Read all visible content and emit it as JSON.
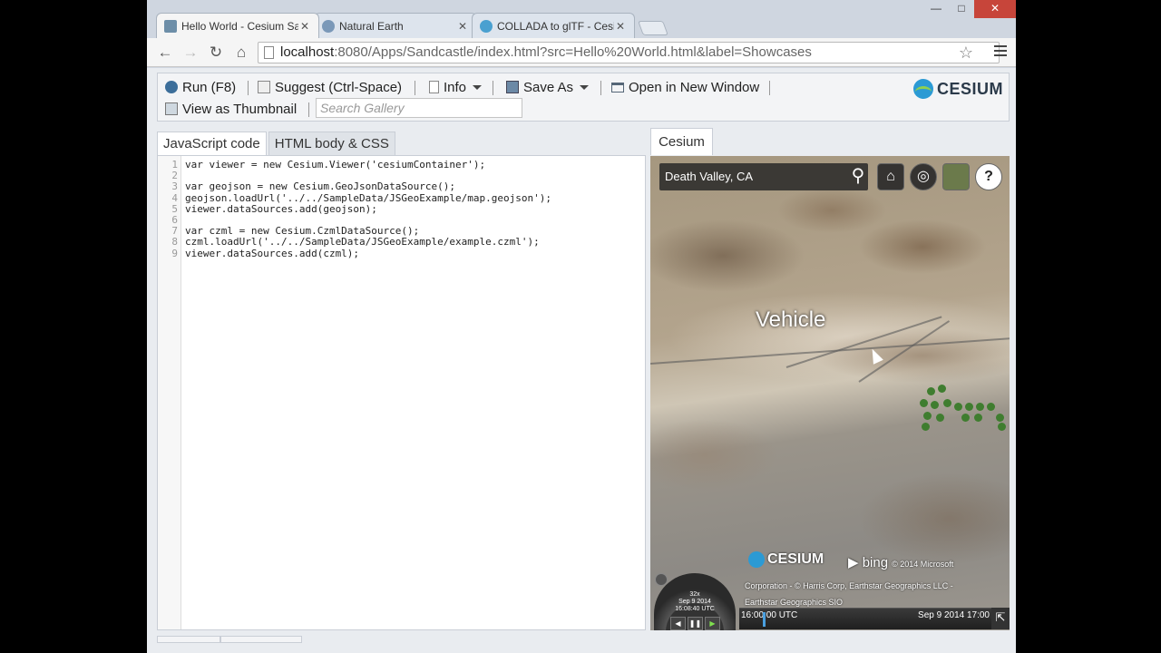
{
  "browser": {
    "tabs": [
      {
        "label": "Hello World - Cesium Sandcastle",
        "icon": "sandcastle-icon",
        "active": true
      },
      {
        "label": "Natural Earth",
        "icon": "globe-icon",
        "active": false
      },
      {
        "label": "COLLADA to glTF - Cesium",
        "icon": "cesium-icon",
        "active": false
      }
    ],
    "url_host": "localhost",
    "url_rest": ":8080/Apps/Sandcastle/index.html?src=Hello%20World.html&label=Showcases"
  },
  "sandcastle": {
    "run_label": "Run (F8)",
    "suggest_label": "Suggest (Ctrl-Space)",
    "info_label": "Info",
    "save_label": "Save As",
    "open_label": "Open in New Window",
    "thumbnail_label": "View as Thumbnail",
    "search_placeholder": "Search Gallery",
    "logo_text": "CESIUM"
  },
  "editor": {
    "tabs": [
      "JavaScript code",
      "HTML body & CSS"
    ],
    "lines": [
      "var viewer = new Cesium.Viewer('cesiumContainer');",
      "",
      "var geojson = new Cesium.GeoJsonDataSource();",
      "geojson.loadUrl('../../SampleData/JSGeoExample/map.geojson');",
      "viewer.dataSources.add(geojson);",
      "",
      "var czml = new Cesium.CzmlDataSource();",
      "czml.loadUrl('../../SampleData/JSGeoExample/example.czml');",
      "viewer.dataSources.add(czml);"
    ]
  },
  "viewer": {
    "tab_label": "Cesium",
    "geocoder_value": "Death Valley, CA",
    "vehicle_label": "Vehicle",
    "credit_logo": "CESIUM",
    "bing_label": "bing",
    "credit_line1": "© 2014 Microsoft",
    "credit_line2": "Corporation - © Harris Corp, Earthstar Geographics LLC -",
    "credit_line3": "Earthstar Geographics SIO",
    "anim_speed": "32x",
    "anim_date": "Sep 9 2014",
    "anim_time": "16:08:40 UTC",
    "timeline_start": "16:00:00 UTC",
    "timeline_end": "Sep 9 2014 17:00"
  }
}
